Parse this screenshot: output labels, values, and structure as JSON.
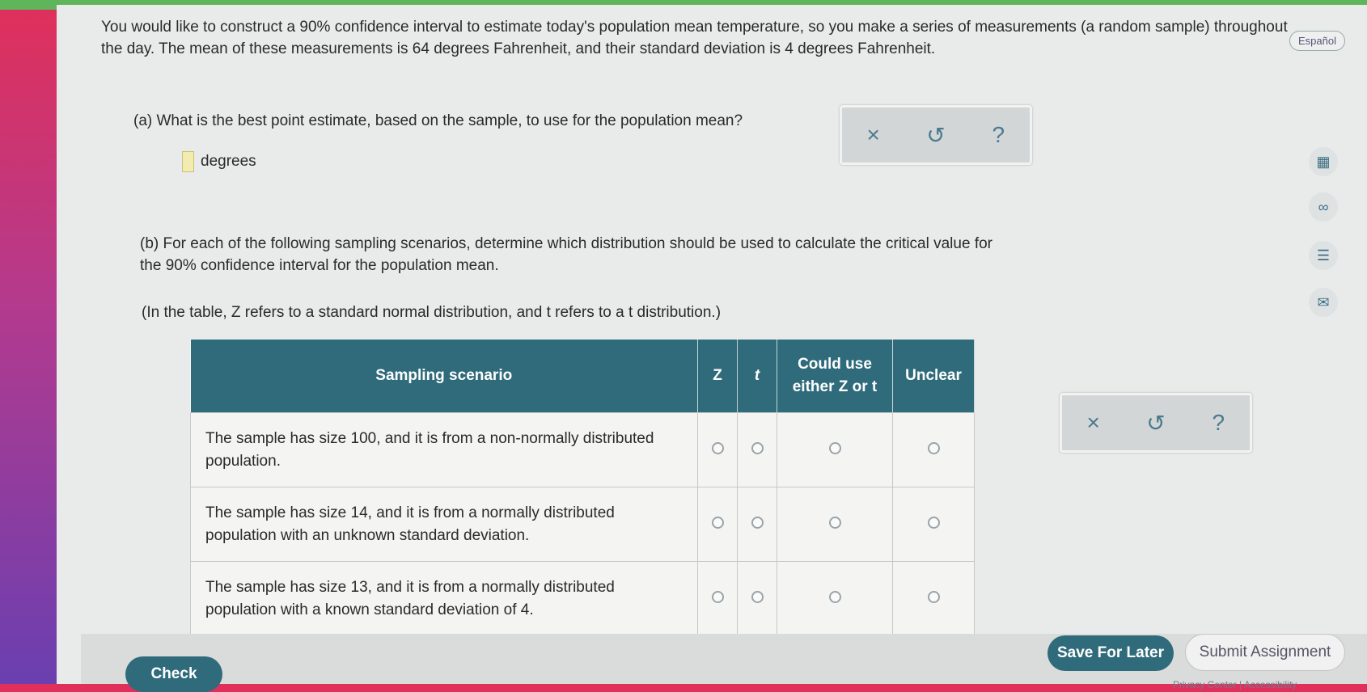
{
  "prompt": "You would like to construct a 90% confidence interval to estimate today's population mean temperature, so you make a series of measurements (a random sample) throughout the day. The mean of these measurements is 64 degrees Fahrenheit, and their standard deviation is 4 degrees Fahrenheit.",
  "language_button": "Español",
  "part_a": {
    "question": "(a) What is the best point estimate, based on the sample, to use for the population mean?",
    "answer_value": "",
    "unit": "degrees"
  },
  "part_b": {
    "question": "(b) For each of the following sampling scenarios, determine which distribution should be used to calculate the critical value for the 90% confidence interval for the population mean.",
    "note": "(In the table, Z refers to a standard normal distribution, and t refers to a t distribution.)",
    "columns": [
      "Sampling scenario",
      "Z",
      "t",
      "Could use either Z or t",
      "Unclear"
    ],
    "rows": [
      "The sample has size 100, and it is from a non-normally distributed population.",
      "The sample has size 14, and it is from a normally distributed population with an unknown standard deviation.",
      "The sample has size 13, and it is from a normally distributed population with a known standard deviation of 4."
    ]
  },
  "tools": {
    "clear": "×",
    "undo": "↺",
    "help": "?"
  },
  "side_icons": [
    "calculator-icon",
    "infinity-icon",
    "notes-icon",
    "mail-icon"
  ],
  "side_glyphs": [
    "▦",
    "∞",
    "☰",
    "✉"
  ],
  "buttons": {
    "check": "Check",
    "save": "Save For Later",
    "submit": "Submit Assignment"
  },
  "footer_links": [
    "Privacy Center",
    "Accessibility"
  ]
}
